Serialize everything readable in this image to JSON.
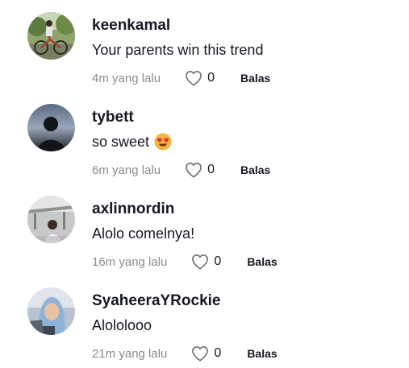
{
  "comments": [
    {
      "username": "keenkamal",
      "text": "Your parents win this trend",
      "time": "4m yang lalu",
      "likes": "0",
      "reply_label": "Balas"
    },
    {
      "username": "tybett",
      "text": "so sweet",
      "emoji": "heart-eyes-emoji",
      "time": "6m yang lalu",
      "likes": "0",
      "reply_label": "Balas"
    },
    {
      "username": "axlinnordin",
      "text": "Alolo comelnya!",
      "time": "16m yang lalu",
      "likes": "0",
      "reply_label": "Balas"
    },
    {
      "username": "SyaheeraYRockie",
      "text": "Alololooo",
      "time": "21m yang lalu",
      "likes": "0",
      "reply_label": "Balas"
    }
  ],
  "icons": {
    "like": "heart-outline-icon"
  },
  "colors": {
    "text_primary": "#161823",
    "text_secondary": "#8a8b91"
  }
}
